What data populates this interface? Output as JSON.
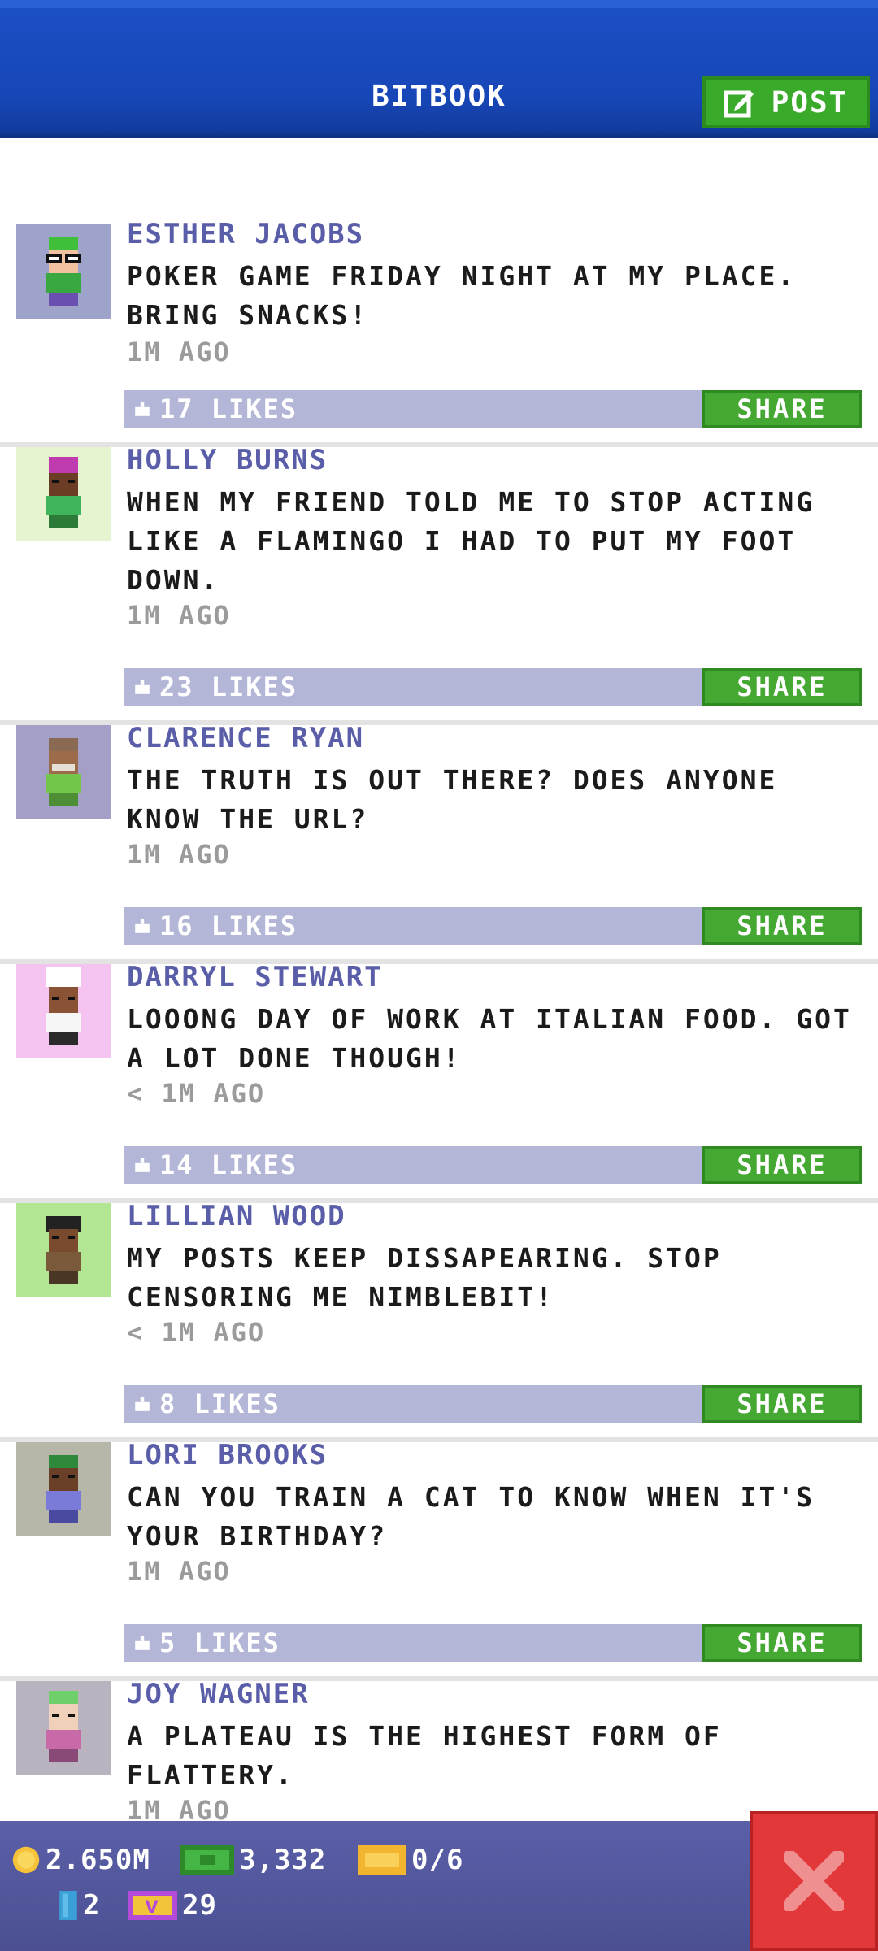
{
  "header": {
    "title": "BITBOOK",
    "post_label": "POST",
    "post_icon": "edit-icon"
  },
  "posts": [
    {
      "author": "ESTHER JACOBS",
      "text": "POKER GAME FRIDAY NIGHT AT MY PLACE. BRING SNACKS!",
      "time": "1M AGO",
      "likes": "17 LIKES",
      "share": "SHARE",
      "avatar_bg": "#9da3c9"
    },
    {
      "author": "HOLLY BURNS",
      "text": "WHEN MY FRIEND TOLD ME TO STOP ACTING LIKE A FLAMINGO I HAD TO PUT MY FOOT DOWN.",
      "time": "1M AGO",
      "likes": "23 LIKES",
      "share": "SHARE",
      "avatar_bg": "#e6f3cf"
    },
    {
      "author": "CLARENCE RYAN",
      "text": "THE TRUTH IS OUT THERE? DOES ANYONE KNOW THE URL?",
      "time": "1M AGO",
      "likes": "16 LIKES",
      "share": "SHARE",
      "avatar_bg": "#a39fc6"
    },
    {
      "author": "DARRYL STEWART",
      "text": "LOOONG DAY OF WORK AT ITALIAN FOOD. GOT A LOT DONE THOUGH!",
      "time": "< 1M AGO",
      "likes": "14 LIKES",
      "share": "SHARE",
      "avatar_bg": "#f5c3ef"
    },
    {
      "author": "LILLIAN WOOD",
      "text": "MY POSTS KEEP DISSAPEARING. STOP CENSORING ME NIMBLEBIT!",
      "time": "< 1M AGO",
      "likes": "8 LIKES",
      "share": "SHARE",
      "avatar_bg": "#b3e693"
    },
    {
      "author": "LORI BROOKS",
      "text": "CAN YOU TRAIN A CAT TO KNOW WHEN IT'S YOUR BIRTHDAY?",
      "time": "1M AGO",
      "likes": "5 LIKES",
      "share": "SHARE",
      "avatar_bg": "#b6b7a8"
    },
    {
      "author": "JOY WAGNER",
      "text": "A PLATEAU IS THE HIGHEST FORM OF FLATTERY.",
      "time": "1M AGO",
      "likes": "",
      "share": "",
      "avatar_bg": "#b9b2bf"
    }
  ],
  "status": {
    "coins": "2.650M",
    "bux": "3,332",
    "tickets": "0/6",
    "keys": "2",
    "vip": "29"
  },
  "colors": {
    "header_blue": "#1746b7",
    "author_purple": "#5a5ea8",
    "share_green": "#44a832",
    "like_bar": "#b3b6d6",
    "close_red": "#e3383a"
  }
}
